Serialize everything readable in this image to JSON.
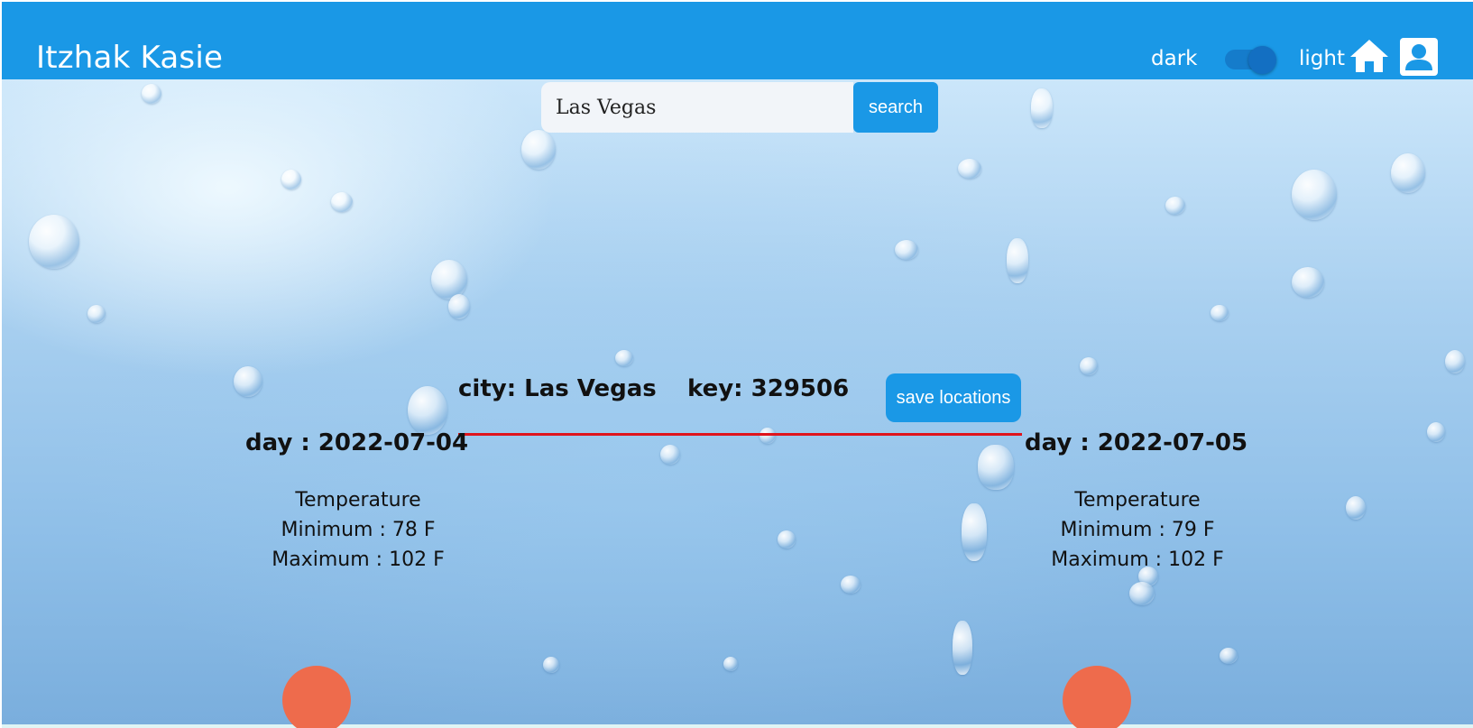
{
  "header": {
    "brand": "Itzhak Kasie",
    "theme_dark_label": "dark",
    "theme_light_label": "light",
    "theme_toggle_on": true,
    "icons": [
      "home-icon",
      "user-icon"
    ],
    "background_color": "#1a98e6"
  },
  "search": {
    "value": "Las Vegas",
    "placeholder": "",
    "button_label": "search"
  },
  "location": {
    "city_text": "city: Las Vegas",
    "key_text": "key: 329506",
    "save_label": "save locations"
  },
  "forecast": [
    {
      "day": "day : 2022-07-04",
      "temperature_label": "Temperature",
      "minimum": "Minimum : 78 F",
      "maximum": "Maximum : 102 F"
    },
    {
      "day": "day : 2022-07-05",
      "temperature_label": "Temperature",
      "minimum": "Minimum : 79 F",
      "maximum": "Maximum : 102 F"
    }
  ],
  "colors": {
    "accent": "#1a98e6",
    "divider": "#e0141c",
    "weather_dot": "#ee6b4c"
  }
}
